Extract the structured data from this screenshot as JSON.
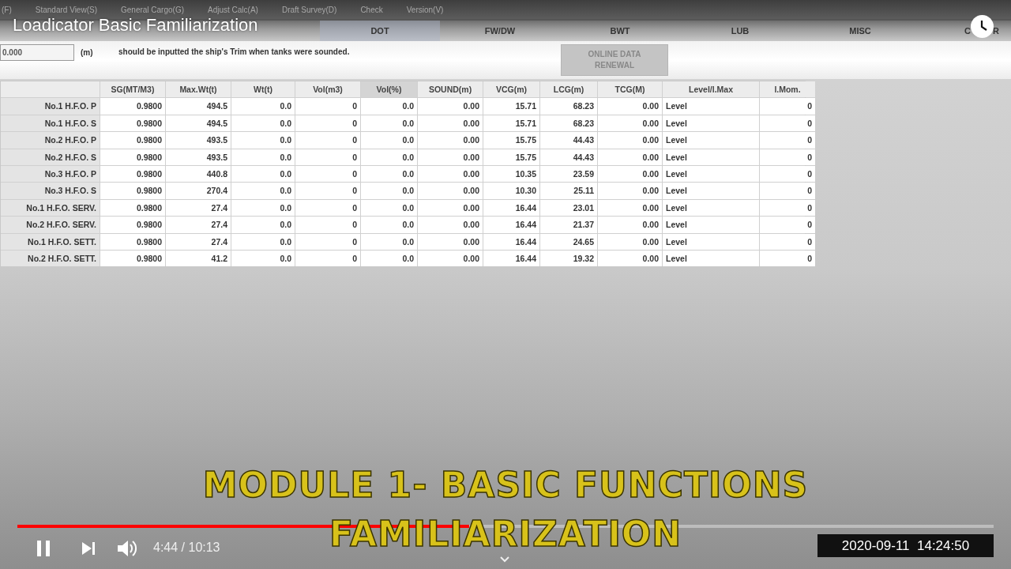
{
  "video": {
    "title": "Loadicator Basic Familiarization"
  },
  "menu": [
    "(F)",
    "Standard View(S)",
    "General Cargo(G)",
    "Adjust Calc(A)",
    "Draft Survey(D)",
    "Check",
    "Version(V)"
  ],
  "tabs": [
    {
      "label": "DOT",
      "selected": true
    },
    {
      "label": "FW/DW",
      "selected": false
    },
    {
      "label": "BWT",
      "selected": false
    },
    {
      "label": "LUB",
      "selected": false
    },
    {
      "label": "MISC",
      "selected": false
    },
    {
      "label": "C",
      "label_after_icon": "R",
      "selected": false
    }
  ],
  "trim": {
    "value": "0.000",
    "unit": "(m)",
    "note": "should be inputted the ship's Trim when tanks were sounded."
  },
  "online_button": {
    "label": "ONLINE DATA RENEWAL",
    "disabled": true
  },
  "table": {
    "columns": [
      {
        "label": "SG(MT/M3)",
        "selected": false
      },
      {
        "label": "Max.Wt(t)",
        "selected": false
      },
      {
        "label": "Wt(t)",
        "selected": false
      },
      {
        "label": "Vol(m3)",
        "selected": false
      },
      {
        "label": "Vol(%)",
        "selected": true
      },
      {
        "label": "SOUND(m)",
        "selected": false
      },
      {
        "label": "VCG(m)",
        "selected": false
      },
      {
        "label": "LCG(m)",
        "selected": false
      },
      {
        "label": "TCG(M)",
        "selected": false
      },
      {
        "label": "Level/l.Max",
        "selected": false
      },
      {
        "label": "l.Mom.",
        "selected": false
      }
    ],
    "rows": [
      {
        "name": "No.1 H.F.O. P",
        "cells": [
          "0.9800",
          "494.5",
          "0.0",
          "0",
          "0.0",
          "0.00",
          "15.71",
          "68.23",
          "0.00",
          "Level",
          "0"
        ]
      },
      {
        "name": "No.1 H.F.O. S",
        "cells": [
          "0.9800",
          "494.5",
          "0.0",
          "0",
          "0.0",
          "0.00",
          "15.71",
          "68.23",
          "0.00",
          "Level",
          "0"
        ]
      },
      {
        "name": "No.2 H.F.O. P",
        "cells": [
          "0.9800",
          "493.5",
          "0.0",
          "0",
          "0.0",
          "0.00",
          "15.75",
          "44.43",
          "0.00",
          "Level",
          "0"
        ]
      },
      {
        "name": "No.2 H.F.O. S",
        "cells": [
          "0.9800",
          "493.5",
          "0.0",
          "0",
          "0.0",
          "0.00",
          "15.75",
          "44.43",
          "0.00",
          "Level",
          "0"
        ]
      },
      {
        "name": "No.3 H.F.O. P",
        "cells": [
          "0.9800",
          "440.8",
          "0.0",
          "0",
          "0.0",
          "0.00",
          "10.35",
          "23.59",
          "0.00",
          "Level",
          "0"
        ]
      },
      {
        "name": "No.3 H.F.O. S",
        "cells": [
          "0.9800",
          "270.4",
          "0.0",
          "0",
          "0.0",
          "0.00",
          "10.30",
          "25.11",
          "0.00",
          "Level",
          "0"
        ]
      },
      {
        "name": "No.1 H.F.O. SERV.",
        "cells": [
          "0.9800",
          "27.4",
          "0.0",
          "0",
          "0.0",
          "0.00",
          "16.44",
          "23.01",
          "0.00",
          "Level",
          "0"
        ]
      },
      {
        "name": "No.2 H.F.O. SERV.",
        "cells": [
          "0.9800",
          "27.4",
          "0.0",
          "0",
          "0.0",
          "0.00",
          "16.44",
          "21.37",
          "0.00",
          "Level",
          "0"
        ]
      },
      {
        "name": "No.1 H.F.O. SETT.",
        "cells": [
          "0.9800",
          "27.4",
          "0.0",
          "0",
          "0.0",
          "0.00",
          "16.44",
          "24.65",
          "0.00",
          "Level",
          "0"
        ]
      },
      {
        "name": "No.2 H.F.O. SETT.",
        "cells": [
          "0.9800",
          "41.2",
          "0.0",
          "0",
          "0.0",
          "0.00",
          "16.44",
          "19.32",
          "0.00",
          "Level",
          "0"
        ]
      }
    ]
  },
  "caption": [
    "MODULE 1- BASIC FUNCTIONS",
    "FAMILIARIZATION"
  ],
  "player": {
    "playing": true,
    "progress": {
      "level": 0.463
    },
    "time": "4:44 / 10:13",
    "timestamp": "2020-09-11  14:24:50"
  }
}
